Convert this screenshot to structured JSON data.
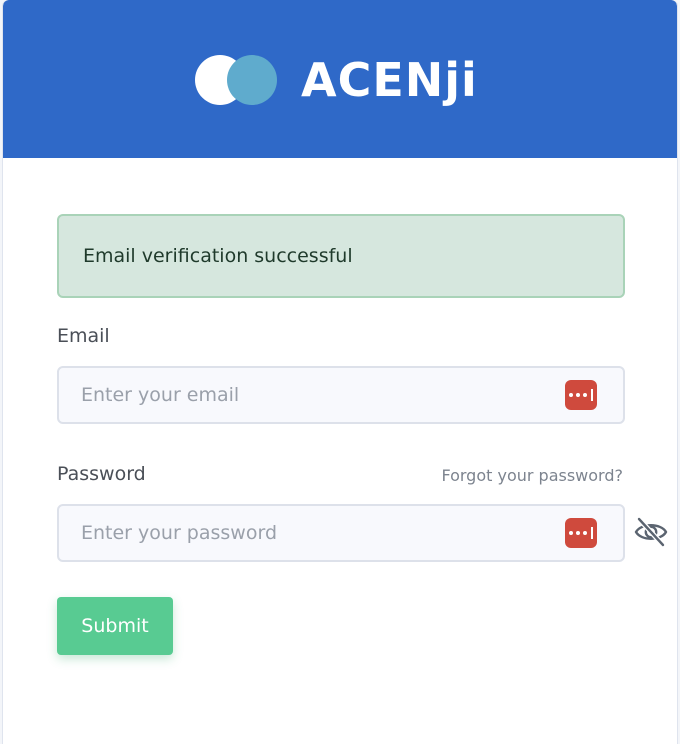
{
  "brand": {
    "name": "ACENji",
    "colors": {
      "header": "#2f69c8",
      "mark_primary": "#ffffff",
      "mark_secondary": "#5fabcd"
    }
  },
  "alert": {
    "message": "Email verification successful",
    "type": "success"
  },
  "form": {
    "email": {
      "label": "Email",
      "placeholder": "Enter your email",
      "value": "",
      "autofill_icon": "password-manager-icon"
    },
    "password": {
      "label": "Password",
      "placeholder": "Enter your password",
      "value": "",
      "autofill_icon": "password-manager-icon",
      "visibility_icon": "eye-slash-icon"
    },
    "forgot_link": "Forgot your password?",
    "submit_label": "Submit",
    "submit_color": "#58cb92"
  }
}
